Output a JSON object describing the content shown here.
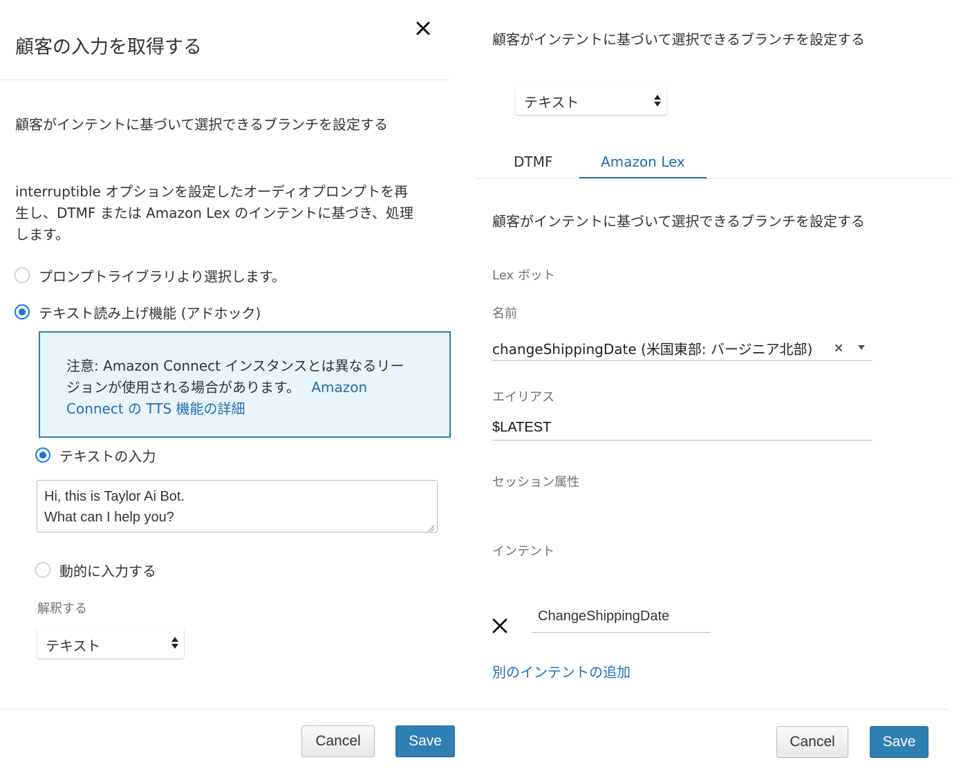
{
  "left": {
    "title": "顧客の入力を取得する",
    "subtitle": "顧客がインテントに基づいて選択できるブランチを設定する",
    "description_lines": [
      "interruptible オプションを設定したオーディオプロンプトを再",
      "生し、DTMF または Amazon Lex のインテントに基づき、処理",
      "します。"
    ],
    "radio_library": "プロンプトライブラリより選択します。",
    "radio_tts": "テキスト読み上げ機能 (アドホック)",
    "notice_lines": [
      "注意: Amazon Connect インスタンスとは異なるリー",
      "ジョンが使用される場合があります。"
    ],
    "notice_link_1": "Amazon",
    "notice_link_2": "Connect の TTS 機能の詳細",
    "radio_text_input": "テキストの入力",
    "textarea_lines": [
      "Hi, this is Taylor Ai Bot.",
      "What can I help you?"
    ],
    "radio_dynamic": "動的に入力する",
    "interpret_label": "解釈する",
    "interpret_select": "テキスト",
    "cancel": "Cancel",
    "save": "Save"
  },
  "right": {
    "subtitle_top": "顧客がインテントに基づいて選択できるブランチを設定する",
    "select_value": "テキスト",
    "tabs": [
      {
        "label": "DTMF",
        "active": false
      },
      {
        "label": "Amazon Lex",
        "active": true
      }
    ],
    "subtitle_tab": "顧客がインテントに基づいて選択できるブランチを設定する",
    "lex_bot_label": "Lex ボット",
    "name_label": "名前",
    "name_value": "changeShippingDate (米国東部: バージニア北部)",
    "alias_label": "エイリアス",
    "alias_value": "$LATEST",
    "session_label": "セッション属性",
    "intent_label": "インテント",
    "intent_value": "ChangeShippingDate",
    "add_intent": "別のインテントの追加",
    "cancel": "Cancel",
    "save": "Save"
  },
  "colors": {
    "accent": "#1a73e8",
    "link": "#1f6fb2",
    "save_button": "#2e7fb3",
    "notice_bg": "#eaf4fb",
    "notice_border": "#2e7fb3"
  },
  "icons": [
    "close-icon",
    "clear-icon",
    "dropdown-arrow-icon",
    "sort-arrows-icon",
    "remove-intent-icon",
    "resize-handle-icon"
  ]
}
